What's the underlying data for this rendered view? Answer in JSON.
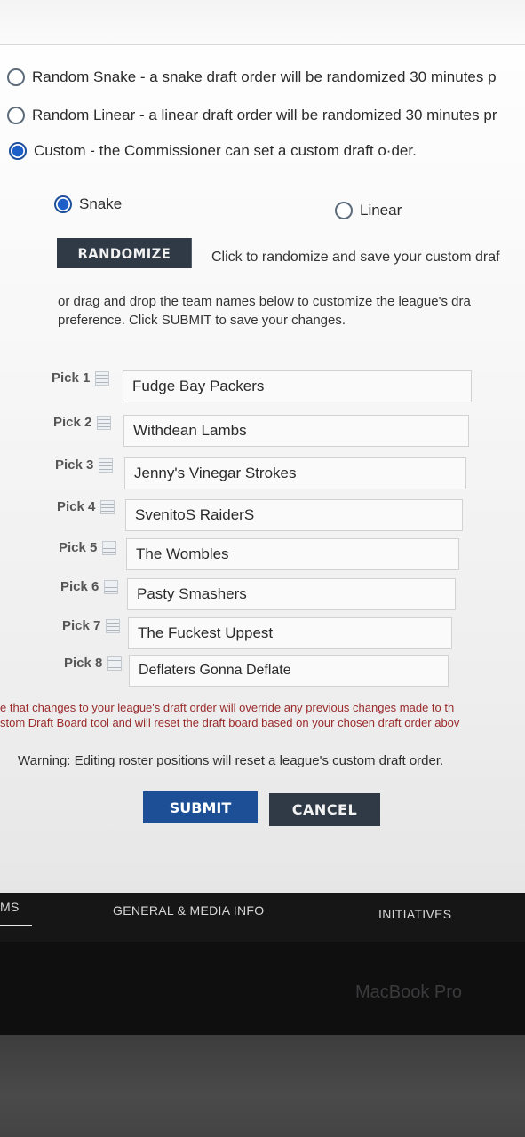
{
  "draft_type_options": [
    {
      "label": "Random Snake - a snake draft order will be randomized 30 minutes p",
      "selected": false
    },
    {
      "label": "Random Linear - a linear draft order will be randomized 30 minutes pr",
      "selected": false
    },
    {
      "label": "Custom - the Commissioner can set a custom draft o·der.",
      "selected": true
    }
  ],
  "custom_order_style": {
    "snake_label": "Snake",
    "linear_label": "Linear",
    "selected": "snake"
  },
  "randomize": {
    "button_label": "RANDOMIZE",
    "hint": "Click to randomize and save your custom draf"
  },
  "instructions": {
    "line1": "or drag and drop the team names below to customize the league's dra",
    "line2": "preference. Click SUBMIT to save your changes."
  },
  "picks": [
    {
      "label": "Pick 1",
      "team": "Fudge Bay Packers"
    },
    {
      "label": "Pick 2",
      "team": "Withdean Lambs"
    },
    {
      "label": "Pick 3",
      "team": "Jenny's Vinegar Strokes"
    },
    {
      "label": "Pick 4",
      "team": "SvenitoS RaiderS"
    },
    {
      "label": "Pick 5",
      "team": "The Wombles"
    },
    {
      "label": "Pick 6",
      "team": "Pasty Smashers"
    },
    {
      "label": "Pick 7",
      "team": "The Fuckest Uppest"
    },
    {
      "label": "Pick 8",
      "team": "Deflaters Gonna Deflate"
    }
  ],
  "override_note": {
    "line1": "e that changes to your league's draft order will override any previous changes made to th",
    "line2": "stom Draft Board tool and will reset the draft board based on your chosen draft order abov"
  },
  "warning": "Warning: Editing roster positions will reset a league's custom draft order.",
  "actions": {
    "submit_label": "SUBMIT",
    "cancel_label": "CANCEL"
  },
  "footer_nav": {
    "item_left": "MS",
    "item_middle": "GENERAL & MEDIA INFO",
    "item_right": "INITIATIVES"
  },
  "device_label": "MacBook Pro",
  "colors": {
    "selected_radio": "#1d5fc8",
    "submit_button": "#1c4f96",
    "dark_button": "#2f3a46",
    "note_text": "#9a2a2a",
    "footer_bg": "#161616"
  }
}
